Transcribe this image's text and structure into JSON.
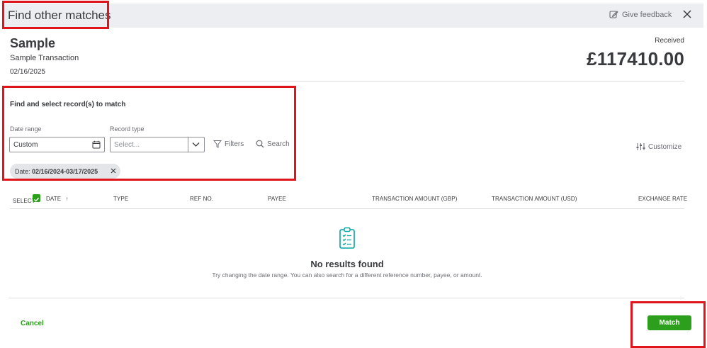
{
  "dialog": {
    "title": "Find other matches",
    "feedback_label": "Give feedback"
  },
  "transaction": {
    "name": "Sample",
    "description": "Sample Transaction",
    "date": "02/16/2025",
    "status_label": "Received",
    "amount": "£117410.00"
  },
  "search": {
    "title": "Find and select record(s) to match",
    "date_range_label": "Date range",
    "date_range_value": "Custom",
    "record_type_label": "Record type",
    "record_type_placeholder": "Select...",
    "filters_label": "Filters",
    "search_label": "Search",
    "chip_prefix": "Date: ",
    "chip_value": "02/16/2024-03/17/2025",
    "customize_label": "Customize"
  },
  "table": {
    "columns": [
      "SELECT",
      "DATE",
      "TYPE",
      "REF NO.",
      "PAYEE",
      "TRANSACTION AMOUNT (GBP)",
      "TRANSACTION AMOUNT (USD)",
      "EXCHANGE RATE"
    ],
    "sort_indicator": "↑"
  },
  "empty_state": {
    "title": "No results found",
    "message": "Try changing the date range. You can also search for a different reference number, payee, or amount."
  },
  "footer": {
    "cancel_label": "Cancel",
    "match_label": "Match"
  },
  "colors": {
    "accent_green": "#2ca01c",
    "highlight_red": "#e0141b"
  }
}
